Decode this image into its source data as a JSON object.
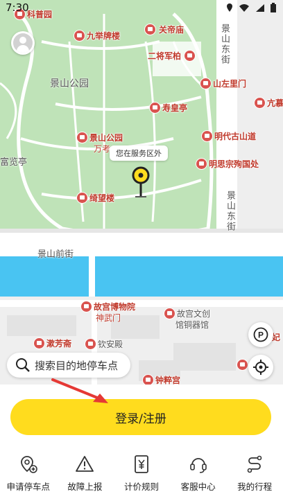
{
  "status_bar": {
    "time": "7:30"
  },
  "map": {
    "tooltip": "您在服务区外",
    "pois": [
      {
        "text": "科普园"
      },
      {
        "text": "九举牌楼"
      },
      {
        "text": "关帝庙"
      },
      {
        "text": "二将军柏"
      },
      {
        "text": "山左里门"
      },
      {
        "text": "寿皇亭"
      },
      {
        "text": "亢慕"
      },
      {
        "text": "明代古山道"
      },
      {
        "text": "景山公园"
      },
      {
        "text": "万考"
      },
      {
        "text": "明思宗殉国处"
      },
      {
        "text": "富览亭"
      },
      {
        "text": "绮望楼"
      },
      {
        "text": "故宫博物院"
      },
      {
        "text": "神武门"
      },
      {
        "text": "故宫文创"
      },
      {
        "text": "馆铜器馆"
      },
      {
        "text": "漱芳斋"
      },
      {
        "text": "钦安殿"
      },
      {
        "text": "钟粹宫"
      },
      {
        "text": "妃"
      }
    ],
    "labels": [
      {
        "text": "景山公园"
      },
      {
        "text": "景山东街"
      },
      {
        "text": "景山东街"
      },
      {
        "text": "景山前街"
      }
    ]
  },
  "search": {
    "placeholder": "搜索目的地停车点"
  },
  "login_button": "登录/注册",
  "bottom_nav": [
    {
      "label": "申请停车点",
      "icon": "location-apply-icon"
    },
    {
      "label": "故障上报",
      "icon": "warning-icon"
    },
    {
      "label": "计价规则",
      "icon": "yuan-icon"
    },
    {
      "label": "客服中心",
      "icon": "headset-icon"
    },
    {
      "label": "我的行程",
      "icon": "route-icon"
    }
  ],
  "colors": {
    "accent": "#ffdc1e",
    "park": "#bfe3b8",
    "water": "#49c4f2",
    "poi": "#d9534f"
  }
}
